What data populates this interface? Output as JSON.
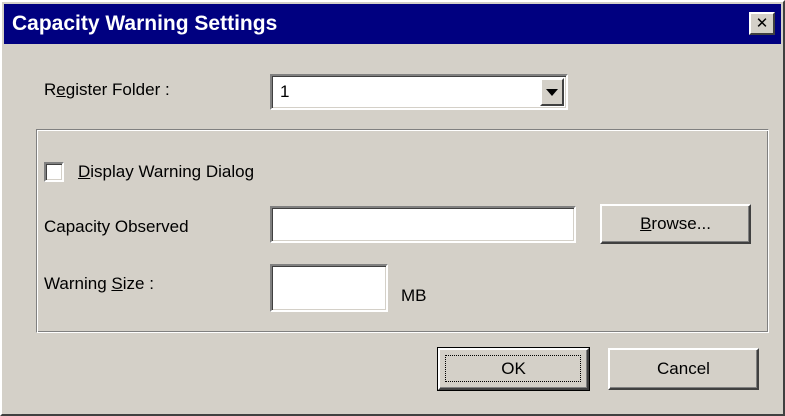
{
  "window": {
    "title": "Capacity Warning Settings",
    "close_icon": "close-icon"
  },
  "register_folder": {
    "label_pre": "R",
    "label_accel": "e",
    "label_post": "gister Folder :",
    "value": "1",
    "dropdown_icon": "chevron-down-icon"
  },
  "display_warning": {
    "label_accel": "D",
    "label_post": "isplay Warning Dialog",
    "checked": false
  },
  "capacity_observed": {
    "label": "Capacity Observed",
    "value": ""
  },
  "browse_button": {
    "label_accel": "B",
    "label_post": "rowse..."
  },
  "warning_size": {
    "label_pre": "Warning ",
    "label_accel": "S",
    "label_post": "ize :",
    "value": "",
    "unit": "MB"
  },
  "buttons": {
    "ok": "OK",
    "cancel": "Cancel"
  },
  "colors": {
    "titlebar": "#000080",
    "face": "#d4d0c8",
    "field": "#ffffff"
  }
}
